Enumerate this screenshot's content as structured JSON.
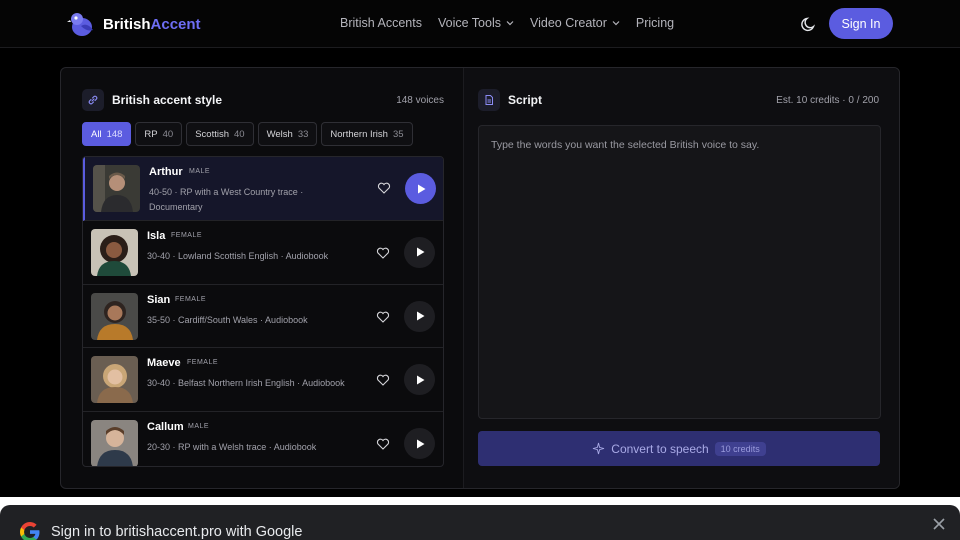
{
  "brand": {
    "name_part1": "British",
    "name_part2": "Accent"
  },
  "nav": {
    "items": [
      {
        "label": "British Accents",
        "dropdown": false
      },
      {
        "label": "Voice Tools",
        "dropdown": true
      },
      {
        "label": "Video Creator",
        "dropdown": true
      },
      {
        "label": "Pricing",
        "dropdown": false
      }
    ],
    "signin_label": "Sign In"
  },
  "accent_panel": {
    "title": "British accent style",
    "voice_count": "148 voices",
    "filters": [
      {
        "label": "All",
        "count": "148",
        "active": true
      },
      {
        "label": "RP",
        "count": "40",
        "active": false
      },
      {
        "label": "Scottish",
        "count": "40",
        "active": false
      },
      {
        "label": "Welsh",
        "count": "33",
        "active": false
      },
      {
        "label": "Northern Irish",
        "count": "35",
        "active": false
      }
    ],
    "voices": [
      {
        "name": "Arthur",
        "gender": "MALE",
        "description": "40-50 · RP with a West Country trace · Documentary",
        "selected": true
      },
      {
        "name": "Isla",
        "gender": "FEMALE",
        "description": "30-40 · Lowland Scottish English · Audiobook",
        "selected": false
      },
      {
        "name": "Sian",
        "gender": "FEMALE",
        "description": "35-50 · Cardiff/South Wales · Audiobook",
        "selected": false
      },
      {
        "name": "Maeve",
        "gender": "FEMALE",
        "description": "30-40 · Belfast Northern Irish English · Audiobook",
        "selected": false
      },
      {
        "name": "Callum",
        "gender": "MALE",
        "description": "20-30 · RP with a Welsh trace · Audiobook",
        "selected": false
      }
    ]
  },
  "script_panel": {
    "title": "Script",
    "meta": "Est. 10 credits · 0 / 200",
    "placeholder": "Type the words you want the selected British voice to say.",
    "convert_label": "Convert to speech",
    "convert_badge": "10 credits"
  },
  "google_prompt": {
    "title": "Sign in to britishaccent.pro with Google"
  },
  "colors": {
    "accent": "#5b5ce0",
    "background": "#000000",
    "card": "#0b0b0d"
  }
}
